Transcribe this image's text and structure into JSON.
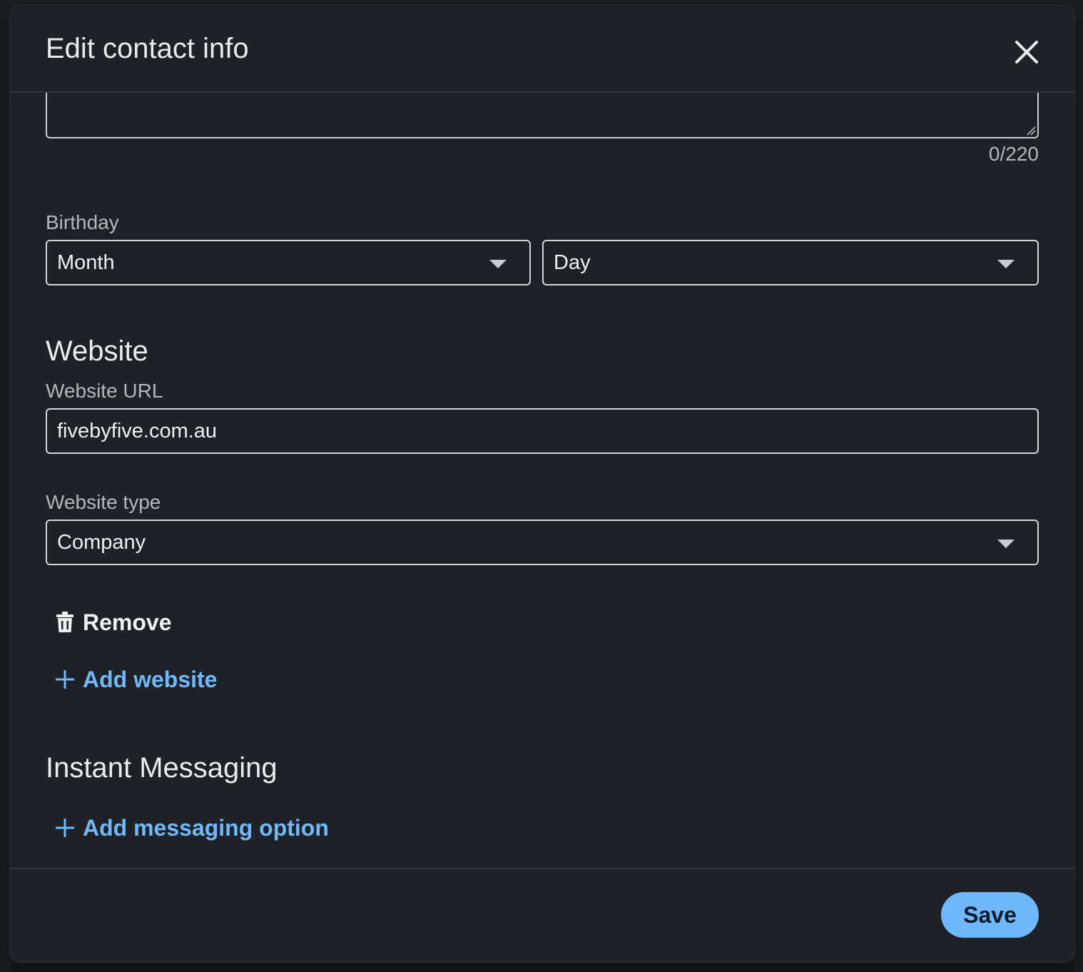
{
  "dialog": {
    "title": "Edit contact info",
    "close_icon": "close-icon"
  },
  "address_field": {
    "char_count": "0/220"
  },
  "birthday": {
    "label": "Birthday",
    "month_value": "Month",
    "day_value": "Day"
  },
  "website": {
    "section_title": "Website",
    "url_label": "Website URL",
    "url_value": "fivebyfive.com.au",
    "type_label": "Website type",
    "type_value": "Company",
    "remove_label": "Remove",
    "add_label": "Add website"
  },
  "instant_messaging": {
    "section_title": "Instant Messaging",
    "add_label": "Add messaging option"
  },
  "footer": {
    "save_label": "Save"
  },
  "colors": {
    "modal_bg": "#1e2226",
    "accent": "#71b7fb",
    "text": "#e9ebed",
    "muted": "#b3b7bb"
  }
}
